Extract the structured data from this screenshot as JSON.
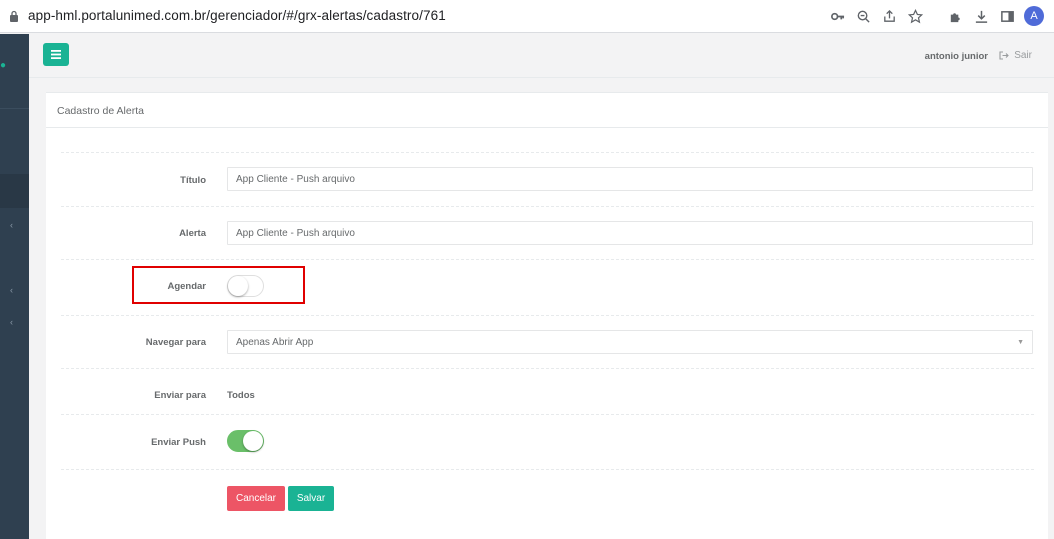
{
  "browser": {
    "url": "app-hml.portalunimed.com.br/gerenciador/#/grx-alertas/cadastro/761",
    "avatar_letter": "A"
  },
  "navbar": {
    "user_name": "antonio junior",
    "logout_label": "Sair"
  },
  "panel": {
    "title": "Cadastro de Alerta"
  },
  "form": {
    "titulo_label": "Título",
    "titulo_value": "App Cliente - Push arquivo",
    "alerta_label": "Alerta",
    "alerta_value": "App Cliente - Push arquivo",
    "agendar_label": "Agendar",
    "agendar_on": false,
    "navegar_label": "Navegar para",
    "navegar_value": "Apenas Abrir App",
    "enviar_para_label": "Enviar para",
    "enviar_para_value": "Todos",
    "enviar_push_label": "Enviar Push",
    "enviar_push_on": true,
    "cancel_label": "Cancelar",
    "save_label": "Salvar"
  },
  "colors": {
    "primary": "#1ab394",
    "danger": "#ed5565",
    "switch_on": "#6abf69",
    "sidebar": "#2f4050",
    "highlight": "#e00000"
  }
}
